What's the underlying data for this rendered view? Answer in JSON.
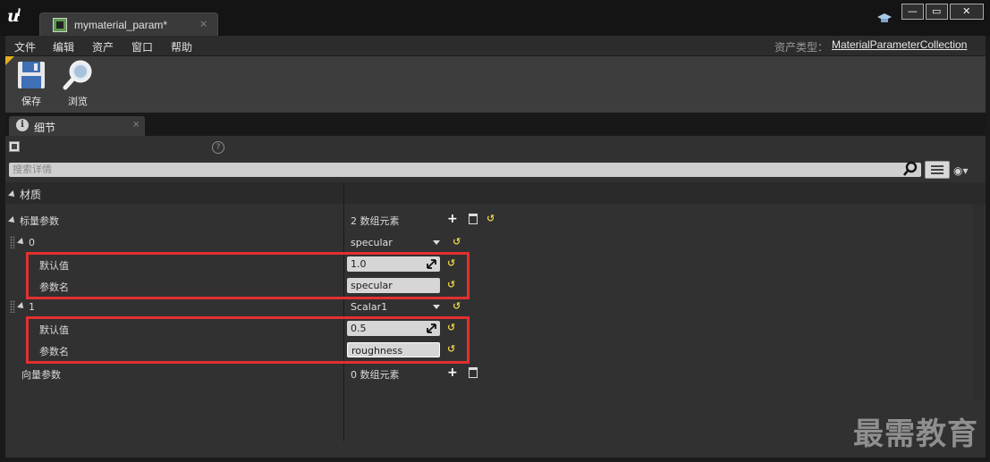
{
  "window": {
    "tab_title": "mymaterial_param*",
    "tab_close": "×",
    "min": "—",
    "max": "▭",
    "close": "✕"
  },
  "menu": {
    "items": [
      "文件",
      "编辑",
      "资产",
      "窗口",
      "帮助"
    ],
    "asset_type_label": "资产类型：",
    "asset_type_value": "MaterialParameterCollection"
  },
  "toolbar": {
    "save_label": "保存",
    "browse_label": "浏览"
  },
  "panel": {
    "tab_title": "细节",
    "tab_close": "×",
    "help_glyph": "?",
    "search_placeholder": "搜索详情"
  },
  "section": {
    "title": "材质"
  },
  "rows": {
    "scalar_params_label": "标量参数",
    "scalar_params_value": "2 数组元素",
    "item0_index": "0",
    "item0_combo": "specular",
    "item0_default_label": "默认值",
    "item0_default_value": "1.0",
    "item0_name_label": "参数名",
    "item0_name_value": "specular",
    "item1_index": "1",
    "item1_combo": "Scalar1",
    "item1_default_label": "默认值",
    "item1_default_value": "0.5",
    "item1_name_label": "参数名",
    "item1_name_value": "roughness",
    "vector_params_label": "向量参数",
    "vector_params_value": "0 数组元素"
  },
  "glyphs": {
    "plus": "+",
    "reset": "↺",
    "eye": "◉▾"
  },
  "watermark": "最需教育",
  "icons": [
    "unreal-logo-icon",
    "material-asset-icon",
    "save-icon",
    "browse-icon",
    "help-hat-icon",
    "info-icon",
    "question-icon",
    "search-icon",
    "list-view-icon",
    "eye-icon",
    "plus-icon",
    "trash-icon",
    "reset-icon"
  ],
  "colors": {
    "highlight": "#e23030",
    "reset_arrow": "#e8d048",
    "toolbar_corner": "#e0b020"
  }
}
